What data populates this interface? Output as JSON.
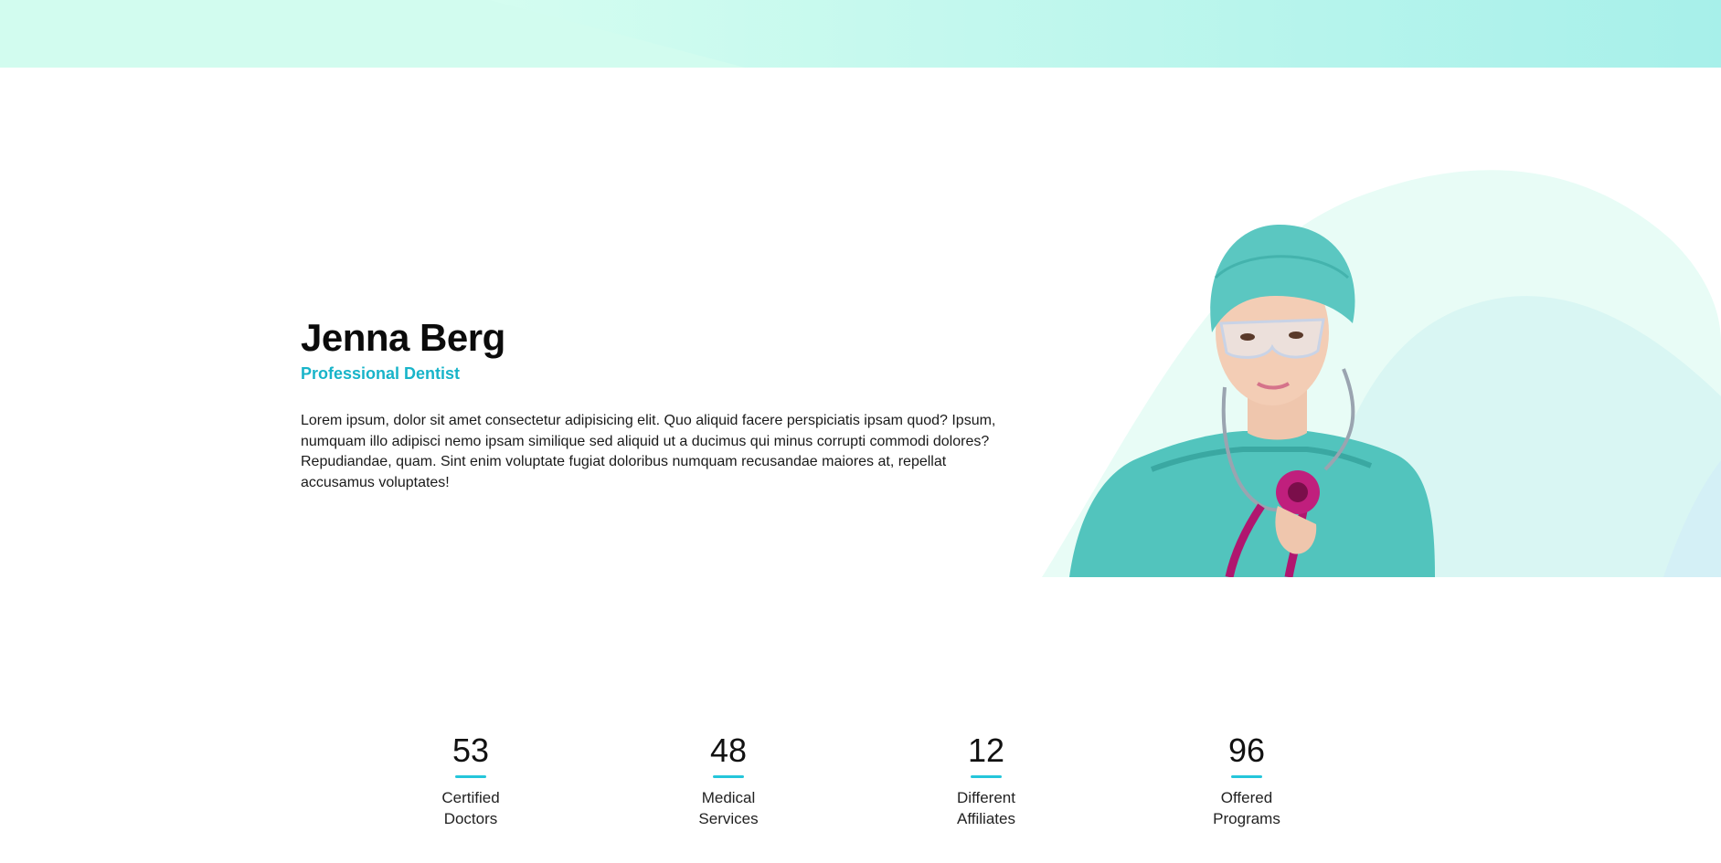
{
  "colors": {
    "band_light": "#cffcef",
    "band_dark": "#a4efe9",
    "accent": "#18b4c9",
    "bar": "#25c6da",
    "scrubs": "#52c4bd",
    "stethoscope": "#b0166f"
  },
  "profile": {
    "name": "Jenna Berg",
    "role": "Professional Dentist",
    "bio": "Lorem ipsum, dolor sit amet consectetur adipisicing elit. Quo aliquid facere perspiciatis ipsam quod? Ipsum, numquam illo adipisci nemo ipsam similique sed aliquid ut a ducimus qui minus corrupti commodi dolores? Repudiandae, quam. Sint enim voluptate fugiat doloribus numquam recusandae maiores at, repellat accusamus voluptates!"
  },
  "stats": [
    {
      "value": "53",
      "label": "Certified Doctors"
    },
    {
      "value": "48",
      "label": "Medical Services"
    },
    {
      "value": "12",
      "label": "Different Affiliates"
    },
    {
      "value": "96",
      "label": "Offered Programs"
    }
  ]
}
